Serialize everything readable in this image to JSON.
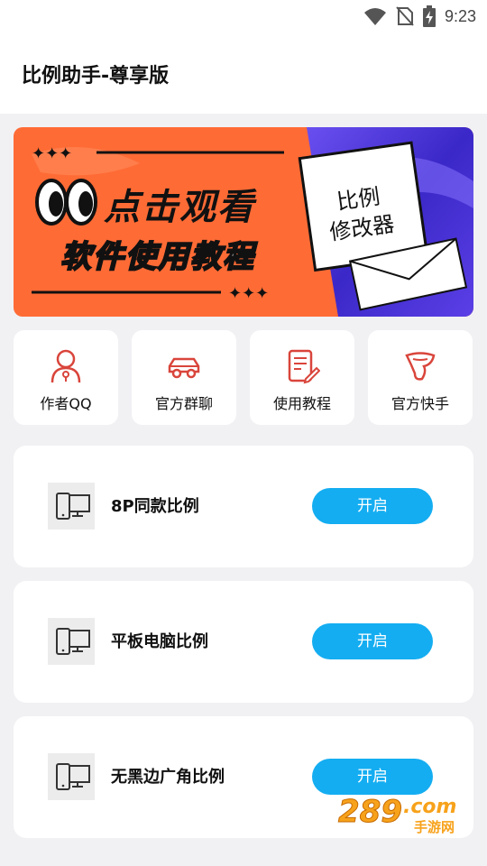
{
  "status_bar": {
    "time": "9:23"
  },
  "app": {
    "title": "比例助手-尊享版"
  },
  "banner": {
    "headline": "点击观看",
    "subline": "软件使用教程",
    "card_text_1": "比例",
    "card_text_2": "修改器",
    "left_color": "#ff6b35",
    "right_color": "#4a2fd1"
  },
  "shortcuts": [
    {
      "label": "作者QQ",
      "icon": "person-icon"
    },
    {
      "label": "官方群聊",
      "icon": "car-icon"
    },
    {
      "label": "使用教程",
      "icon": "document-icon"
    },
    {
      "label": "官方快手",
      "icon": "kuaishou-icon"
    }
  ],
  "ratios": [
    {
      "label": "8P同款比例",
      "button": "开启"
    },
    {
      "label": "平板电脑比例",
      "button": "开启"
    },
    {
      "label": "无黑边广角比例",
      "button": "开启"
    }
  ],
  "watermark": {
    "text": "289",
    "suffix": ".com",
    "sub": "手游网"
  },
  "colors": {
    "accent": "#14adf1",
    "icon_red": "#d9453b",
    "background": "#f1f1f4"
  }
}
